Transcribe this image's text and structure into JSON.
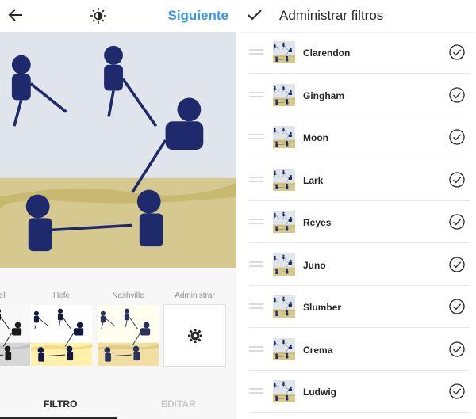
{
  "editor": {
    "next_label": "Siguiente",
    "filters": [
      {
        "label": "...ell"
      },
      {
        "label": "Hefe"
      },
      {
        "label": "Nashville"
      },
      {
        "label": "Administrar"
      }
    ],
    "tabs": [
      {
        "label": "FILTRO",
        "active": true
      },
      {
        "label": "EDITAR",
        "active": false
      }
    ]
  },
  "manage": {
    "title": "Administrar filtros",
    "filters": [
      {
        "name": "Clarendon",
        "enabled": true
      },
      {
        "name": "Gingham",
        "enabled": true
      },
      {
        "name": "Moon",
        "enabled": true
      },
      {
        "name": "Lark",
        "enabled": true
      },
      {
        "name": "Reyes",
        "enabled": true
      },
      {
        "name": "Juno",
        "enabled": true
      },
      {
        "name": "Slumber",
        "enabled": true
      },
      {
        "name": "Crema",
        "enabled": true
      },
      {
        "name": "Ludwig",
        "enabled": true
      }
    ]
  },
  "colors": {
    "accent": "#3897f0",
    "text": "#262626",
    "muted": "#8e8e8e",
    "inactive_tab": "#c7c7c7"
  },
  "icons": {
    "back": "back-arrow-icon",
    "brightness": "brightness-icon",
    "manage": "gear-icon",
    "done": "checkmark-icon",
    "reorder": "drag-handle-icon",
    "toggle": "check-circle-icon"
  }
}
